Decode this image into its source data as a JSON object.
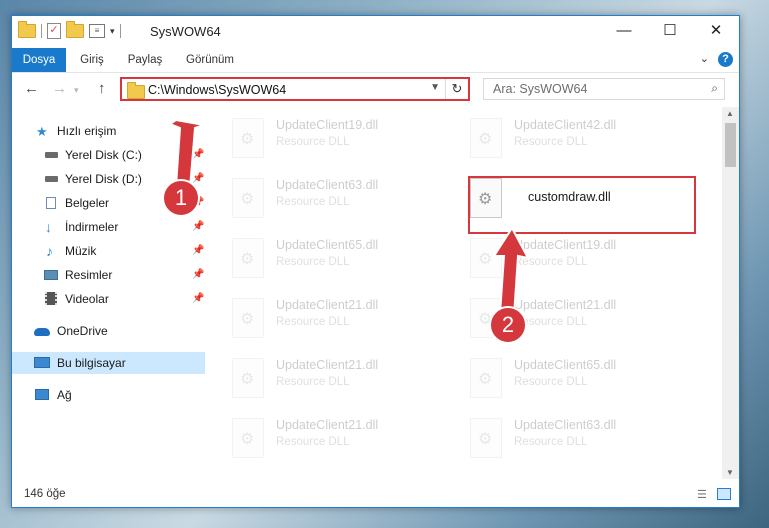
{
  "window": {
    "title": "SysWOW64",
    "minimize": "—",
    "maximize": "☐",
    "close": "✕"
  },
  "ribbon": {
    "tabs": [
      "Dosya",
      "Giriş",
      "Paylaş",
      "Görünüm"
    ],
    "help": "?"
  },
  "nav": {
    "back": "←",
    "forward": "→",
    "up": "↑",
    "address": "C:\\Windows\\SysWOW64",
    "refresh": "↻",
    "search_placeholder": "Ara: SysWOW64"
  },
  "sidebar": {
    "items": [
      {
        "label": "Hızlı erişim",
        "icon": "star-icon",
        "color": "#2f8bd6"
      },
      {
        "label": "Yerel Disk (C:)",
        "icon": "drive-icon",
        "color": "#6b6b6b"
      },
      {
        "label": "Yerel Disk (D:)",
        "icon": "drive-icon",
        "color": "#6b6b6b"
      },
      {
        "label": "Belgeler",
        "icon": "document-icon",
        "color": "#6b8db3"
      },
      {
        "label": "İndirmeler",
        "icon": "download-icon",
        "color": "#2f8bd6"
      },
      {
        "label": "Müzik",
        "icon": "music-icon",
        "color": "#2f8bd6"
      },
      {
        "label": "Resimler",
        "icon": "pictures-icon",
        "color": "#5a8fb5"
      },
      {
        "label": "Videolar",
        "icon": "video-icon",
        "color": "#555555"
      },
      {
        "label": "OneDrive",
        "icon": "cloud-icon",
        "color": "#1e6fc2"
      },
      {
        "label": "Bu bilgisayar",
        "icon": "computer-icon",
        "color": "#3b89d0"
      },
      {
        "label": "Ağ",
        "icon": "network-icon",
        "color": "#3b89d0"
      }
    ]
  },
  "files": {
    "left": [
      {
        "name": "UpdateClient19.dll",
        "type": "Resource DLL"
      },
      {
        "name": "UpdateClient63.dll",
        "type": "Resource DLL"
      },
      {
        "name": "UpdateClient65.dll",
        "type": "Resource DLL"
      },
      {
        "name": "UpdateClient21.dll",
        "type": "Resource DLL"
      },
      {
        "name": "UpdateClient21.dll",
        "type": "Resource DLL"
      },
      {
        "name": "UpdateClient21.dll",
        "type": "Resource DLL"
      }
    ],
    "right": [
      {
        "name": "UpdateClient42.dll",
        "type": "Resource DLL"
      },
      {
        "name": "customdraw.dll",
        "type": ""
      },
      {
        "name": "UpdateClient19.dll",
        "type": "Resource DLL"
      },
      {
        "name": "UpdateClient21.dll",
        "type": "Resource DLL"
      },
      {
        "name": "UpdateClient65.dll",
        "type": "Resource DLL"
      },
      {
        "name": "UpdateClient63.dll",
        "type": "Resource DLL"
      }
    ]
  },
  "annotations": {
    "badge1": "1",
    "badge2": "2",
    "color": "#d4373c"
  },
  "status": {
    "count": "146 öğe"
  }
}
